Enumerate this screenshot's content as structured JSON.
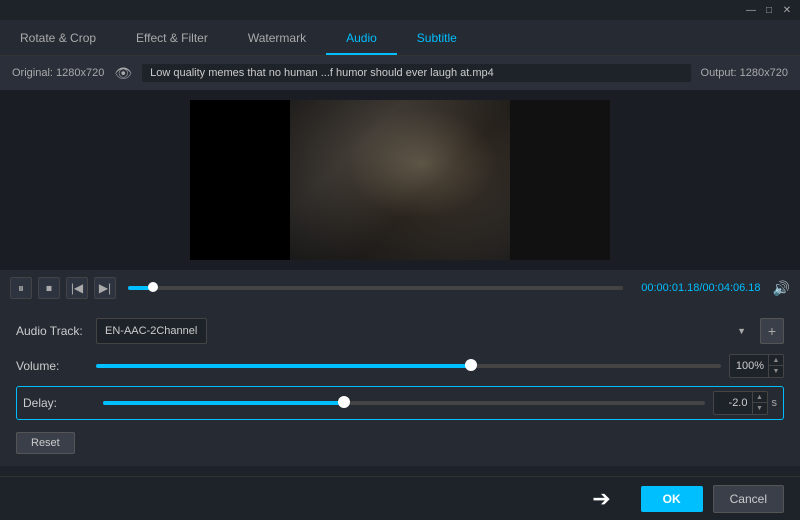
{
  "titlebar": {
    "minimize_label": "—",
    "maximize_label": "□",
    "close_label": "✕"
  },
  "tabs": [
    {
      "id": "rotate-crop",
      "label": "Rotate & Crop",
      "active": false
    },
    {
      "id": "effect-filter",
      "label": "Effect & Filter",
      "active": false
    },
    {
      "id": "watermark",
      "label": "Watermark",
      "active": false
    },
    {
      "id": "audio",
      "label": "Audio",
      "active": true
    },
    {
      "id": "subtitle",
      "label": "Subtitle",
      "active": false
    }
  ],
  "infobar": {
    "original_label": "Original: 1280x720",
    "filename": "Low quality memes that no human ...f humor should ever laugh at.mp4",
    "output_label": "Output: 1280x720"
  },
  "playback": {
    "time_current": "00:00:01.18",
    "time_separator": "/",
    "time_total": "00:04:06.18",
    "progress_percent": 5
  },
  "controls": {
    "pause_label": "⏸",
    "stop_label": "⏹",
    "prev_label": "|◀",
    "next_label": "▶|"
  },
  "audio": {
    "track_label": "Audio Track:",
    "track_value": "EN-AAC-2Channel",
    "add_label": "+",
    "volume_label": "Volume:",
    "volume_value": "100%",
    "volume_percent": 60,
    "delay_label": "Delay:",
    "delay_value": "-2.0",
    "delay_unit": "s",
    "delay_percent": 40,
    "reset_label": "Reset"
  },
  "footer": {
    "ok_label": "OK",
    "cancel_label": "Cancel"
  }
}
